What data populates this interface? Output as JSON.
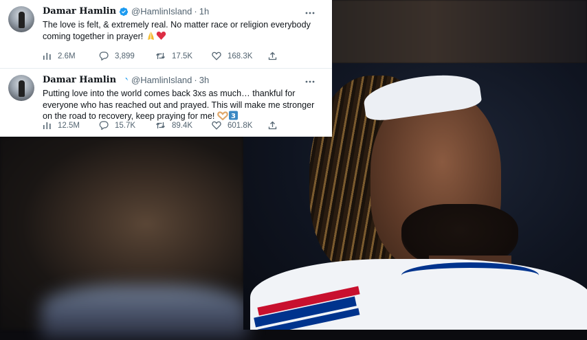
{
  "tweets": [
    {
      "name": "Damar Hamlin",
      "handle": "@HamlinIsland",
      "time": "1h",
      "text": "The love is felt, & extremely real. No matter race or religion everybody coming together in prayer!",
      "emojis": [
        "folded-hands",
        "red-heart"
      ],
      "stats": {
        "views": "2.6M",
        "replies": "3,899",
        "retweets": "17.5K",
        "likes": "168.3K"
      }
    },
    {
      "name": "Damar Hamlin",
      "handle": "@HamlinIsland",
      "time": "3h",
      "text": "Putting love into the world comes back 3xs as much… thankful for everyone who has reached out and prayed. This will make me stronger on the road to recovery, keep praying for me!",
      "emojis": [
        "heart-hands",
        "keycap-3"
      ],
      "stats": {
        "views": "12.5M",
        "replies": "15.7K",
        "retweets": "89.4K",
        "likes": "601.8K"
      }
    }
  ],
  "colors": {
    "verified": "#1d9bf0",
    "text": "#0f1419",
    "secondary": "#536471",
    "bills_blue": "#00338d",
    "bills_red": "#c8102e"
  }
}
